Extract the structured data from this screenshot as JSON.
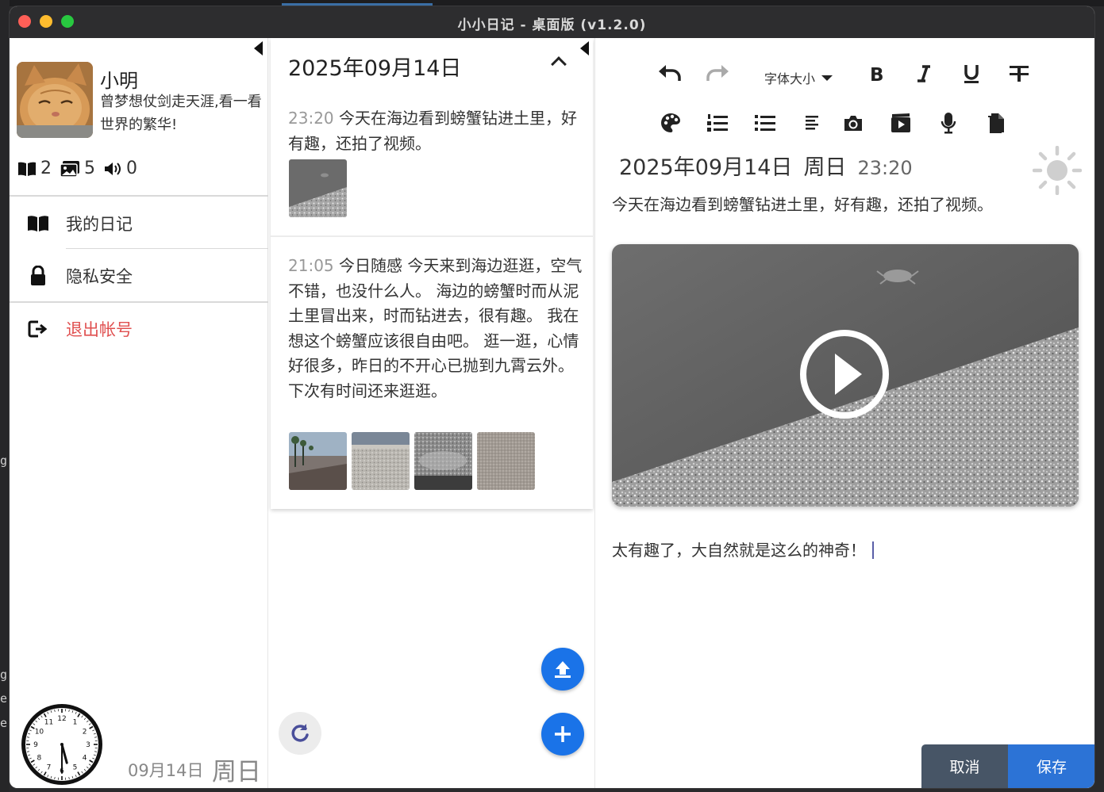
{
  "app": {
    "title": "小小日记 - 桌面版 (v1.2.0)"
  },
  "profile": {
    "name": "小明",
    "motto": "曾梦想仗剑走天涯,看一看世界的繁华!",
    "stats": {
      "diaries": "2",
      "images": "5",
      "audio": "0"
    }
  },
  "sidebar": {
    "menu": [
      {
        "label": "我的日记",
        "icon": "book-open-icon"
      },
      {
        "label": "隐私安全",
        "icon": "lock-icon"
      },
      {
        "label": "退出帐号",
        "icon": "logout-icon"
      }
    ],
    "footer_date": "09月14日",
    "footer_weekday": "周日",
    "clock": {
      "hour": 5,
      "minute": 30
    }
  },
  "list": {
    "date_header": "2025年09月14日",
    "entries": [
      {
        "time": "23:20",
        "text": "今天在海边看到螃蟹钻进土里，好有趣，还拍了视频。",
        "thumbs": 1
      },
      {
        "time": "21:05",
        "text": "今日随感  今天来到海边逛逛，空气不错，也没什么人。  海边的螃蟹时而从泥土里冒出来，时而钻进去，很有趣。  我在想这个螃蟹应该很自由吧。  逛一逛，心情好很多，昨日的不开心已抛到九霄云外。  下次有时间还来逛逛。",
        "thumbs": 4
      }
    ]
  },
  "toolbar": {
    "font_size_label": "字体大小",
    "tools_row1": [
      "undo-icon",
      "redo-icon",
      "bold-icon",
      "italic-icon",
      "underline-icon",
      "strikethrough-icon"
    ],
    "tools_row2": [
      "palette-icon",
      "ordered-list-icon",
      "bullet-list-icon",
      "align-left-icon",
      "camera-icon",
      "video-icon",
      "microphone-icon",
      "attachment-icon"
    ]
  },
  "editor": {
    "date": "2025年09月14日",
    "weekday": "周日",
    "time": "23:20",
    "weather_icon": "sun-icon",
    "paragraph1": "今天在海边看到螃蟹钻进土里，好有趣，还拍了视频。",
    "paragraph2": "太有趣了，大自然就是这么的神奇！",
    "cancel_label": "取消",
    "save_label": "保存"
  },
  "colors": {
    "accent": "#1a73e8",
    "logout": "#e05050",
    "save": "#2c73d6",
    "cancel": "#475566"
  }
}
